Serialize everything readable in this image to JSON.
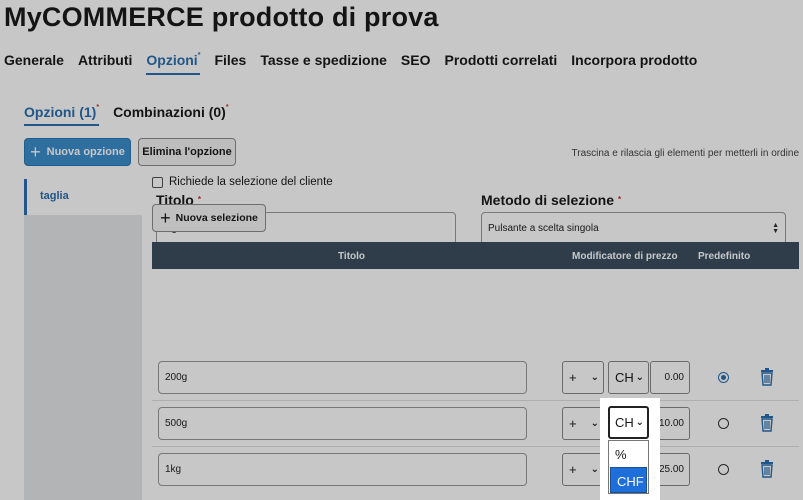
{
  "page_title": "MyCOMMERCE prodotto di prova",
  "main_tabs": [
    {
      "label": "Generale"
    },
    {
      "label": "Attributi"
    },
    {
      "label": "Opzioni",
      "marker": "*"
    },
    {
      "label": "Files"
    },
    {
      "label": "Tasse e spedizione"
    },
    {
      "label": "SEO"
    },
    {
      "label": "Prodotti correlati"
    },
    {
      "label": "Incorpora prodotto"
    }
  ],
  "sub_tabs": [
    {
      "label": "Opzioni (1)",
      "marker": "*"
    },
    {
      "label": "Combinazioni (0)",
      "marker": "*"
    }
  ],
  "toolbar": {
    "new_option": "Nuova opzione",
    "delete_option": "Elimina l'opzione",
    "drag_hint": "Trascina e rilascia gli elementi per metterli in ordine"
  },
  "sidebar": {
    "items": [
      {
        "label": "taglia"
      }
    ]
  },
  "form": {
    "title_label": "Titolo",
    "required_marker": "*",
    "title_value": "taglia",
    "method_label": "Metodo di selezione",
    "method_value": "Pulsante a scelta singola",
    "require_selection_label": "Richiede la selezione del cliente",
    "new_selection": "Nuova selezione"
  },
  "table": {
    "headers": {
      "title": "Titolo",
      "price_modifier": "Modificatore di prezzo",
      "default": "Predefinito"
    },
    "rows": [
      {
        "title": "200g",
        "sign": "+",
        "unit": "CH",
        "amount": "0.00",
        "default": true
      },
      {
        "title": "500g",
        "sign": "+",
        "unit": "CH",
        "amount": "10.00",
        "default": false
      },
      {
        "title": "1kg",
        "sign": "+",
        "unit": "CH",
        "amount": "25.00",
        "default": false
      }
    ]
  },
  "unit_dropdown": {
    "options": [
      "%",
      "CHF"
    ],
    "selected": "CHF"
  },
  "colors": {
    "accent": "#2a6fb0",
    "primary_button": "#3d8fce",
    "table_header": "#3d4f60",
    "dropdown_highlight": "#1e6fd9"
  }
}
